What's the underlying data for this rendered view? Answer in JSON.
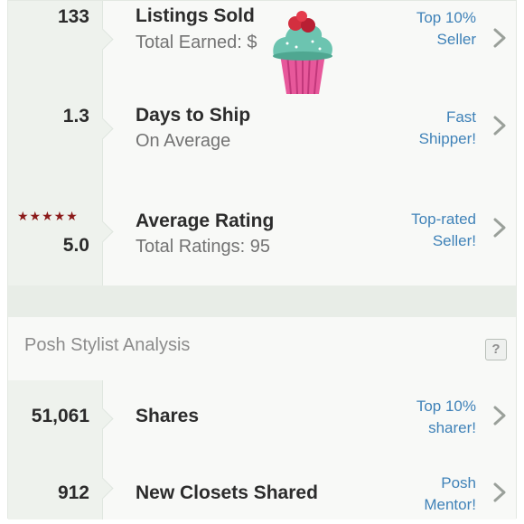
{
  "seller_stats": [
    {
      "value": "133",
      "title": "Listings Sold",
      "subtitle": "Total Earned: $",
      "status_line1": "Top 10%",
      "status_line2": "Seller"
    },
    {
      "value": "1.3",
      "title": "Days to Ship",
      "subtitle": "On Average",
      "status_line1": "Fast",
      "status_line2": "Shipper!"
    },
    {
      "value": "5.0",
      "stars": "★★★★★",
      "title": "Average Rating",
      "subtitle": "Total Ratings: 95",
      "status_line1": "Top-rated",
      "status_line2": "Seller!"
    }
  ],
  "section": {
    "title": "Posh Stylist Analysis",
    "help": "?"
  },
  "stylist_stats": [
    {
      "value": "51,061",
      "title": "Shares",
      "status_line1": "Top 10%",
      "status_line2": "sharer!"
    },
    {
      "value": "912",
      "title": "New Closets Shared",
      "status_line1": "Posh",
      "status_line2": "Mentor!"
    }
  ],
  "colors": {
    "status": "#3f82b8",
    "stars": "#8b1a1a",
    "icon_frosting": "#6cc4b0",
    "icon_cup": "#e7589b",
    "icon_cherry": "#d32f3f"
  },
  "decor": {
    "sticker_icon": "cupcake-icon"
  }
}
